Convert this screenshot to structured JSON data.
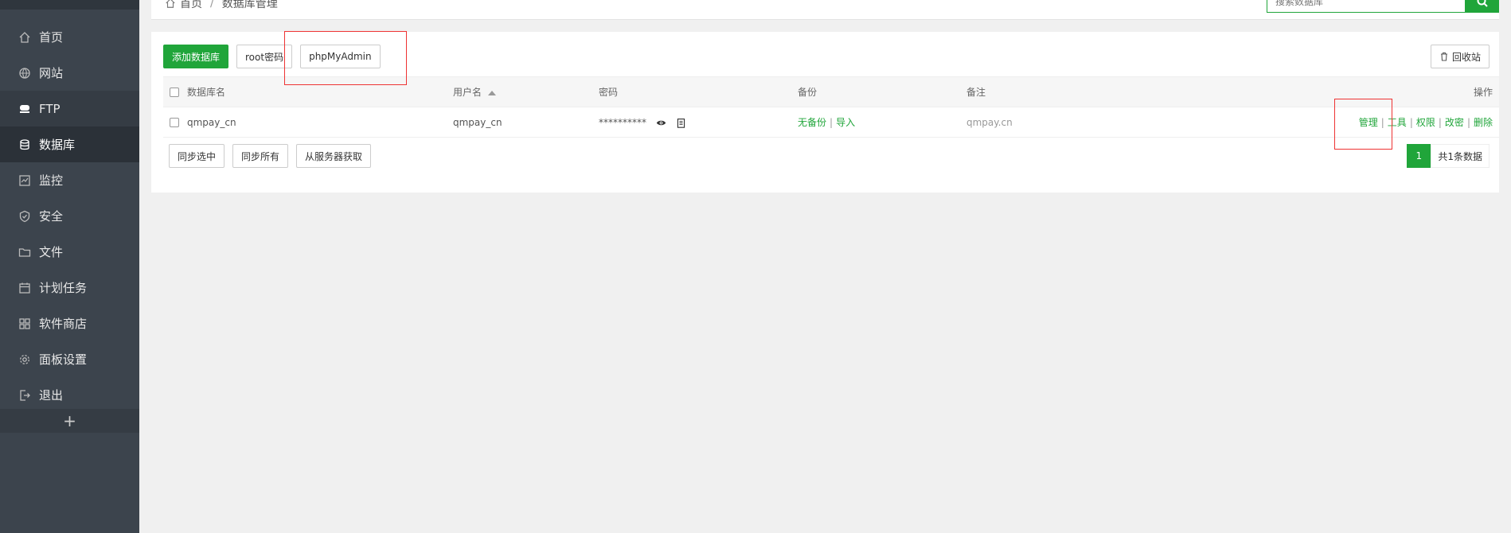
{
  "sidebar": {
    "items": [
      {
        "label": "首页",
        "icon": "home-icon"
      },
      {
        "label": "网站",
        "icon": "globe-icon"
      },
      {
        "label": "FTP",
        "icon": "ftp-icon"
      },
      {
        "label": "数据库",
        "icon": "database-icon"
      },
      {
        "label": "监控",
        "icon": "monitor-icon"
      },
      {
        "label": "安全",
        "icon": "shield-icon"
      },
      {
        "label": "文件",
        "icon": "folder-icon"
      },
      {
        "label": "计划任务",
        "icon": "calendar-icon"
      },
      {
        "label": "软件商店",
        "icon": "apps-icon"
      },
      {
        "label": "面板设置",
        "icon": "gear-icon"
      },
      {
        "label": "退出",
        "icon": "logout-icon"
      }
    ],
    "add": "+"
  },
  "breadcrumb": {
    "home": "首页",
    "sep": "/",
    "current": "数据库管理"
  },
  "search": {
    "placeholder": "搜索数据库"
  },
  "toolbar": {
    "add_db": "添加数据库",
    "root_pw": "root密码",
    "phpmyadmin": "phpMyAdmin",
    "recycle": "回收站"
  },
  "table": {
    "headers": {
      "name": "数据库名",
      "user": "用户名",
      "password": "密码",
      "backup": "备份",
      "note": "备注",
      "ops": "操作"
    },
    "rows": [
      {
        "name": "qmpay_cn",
        "user": "qmpay_cn",
        "password": "**********",
        "backup_none": "无备份",
        "import": "导入",
        "note": "qmpay.cn",
        "ops": {
          "manage": "管理",
          "tools": "工具",
          "perm": "权限",
          "changepw": "改密",
          "delete": "删除"
        }
      }
    ]
  },
  "bottom": {
    "sync_selected": "同步选中",
    "sync_all": "同步所有",
    "fetch_server": "从服务器获取"
  },
  "pager": {
    "page": "1",
    "total": "共1条数据"
  },
  "colors": {
    "accent": "#20a53a",
    "sidebar": "#3c444d",
    "highlight": "#e33333"
  }
}
